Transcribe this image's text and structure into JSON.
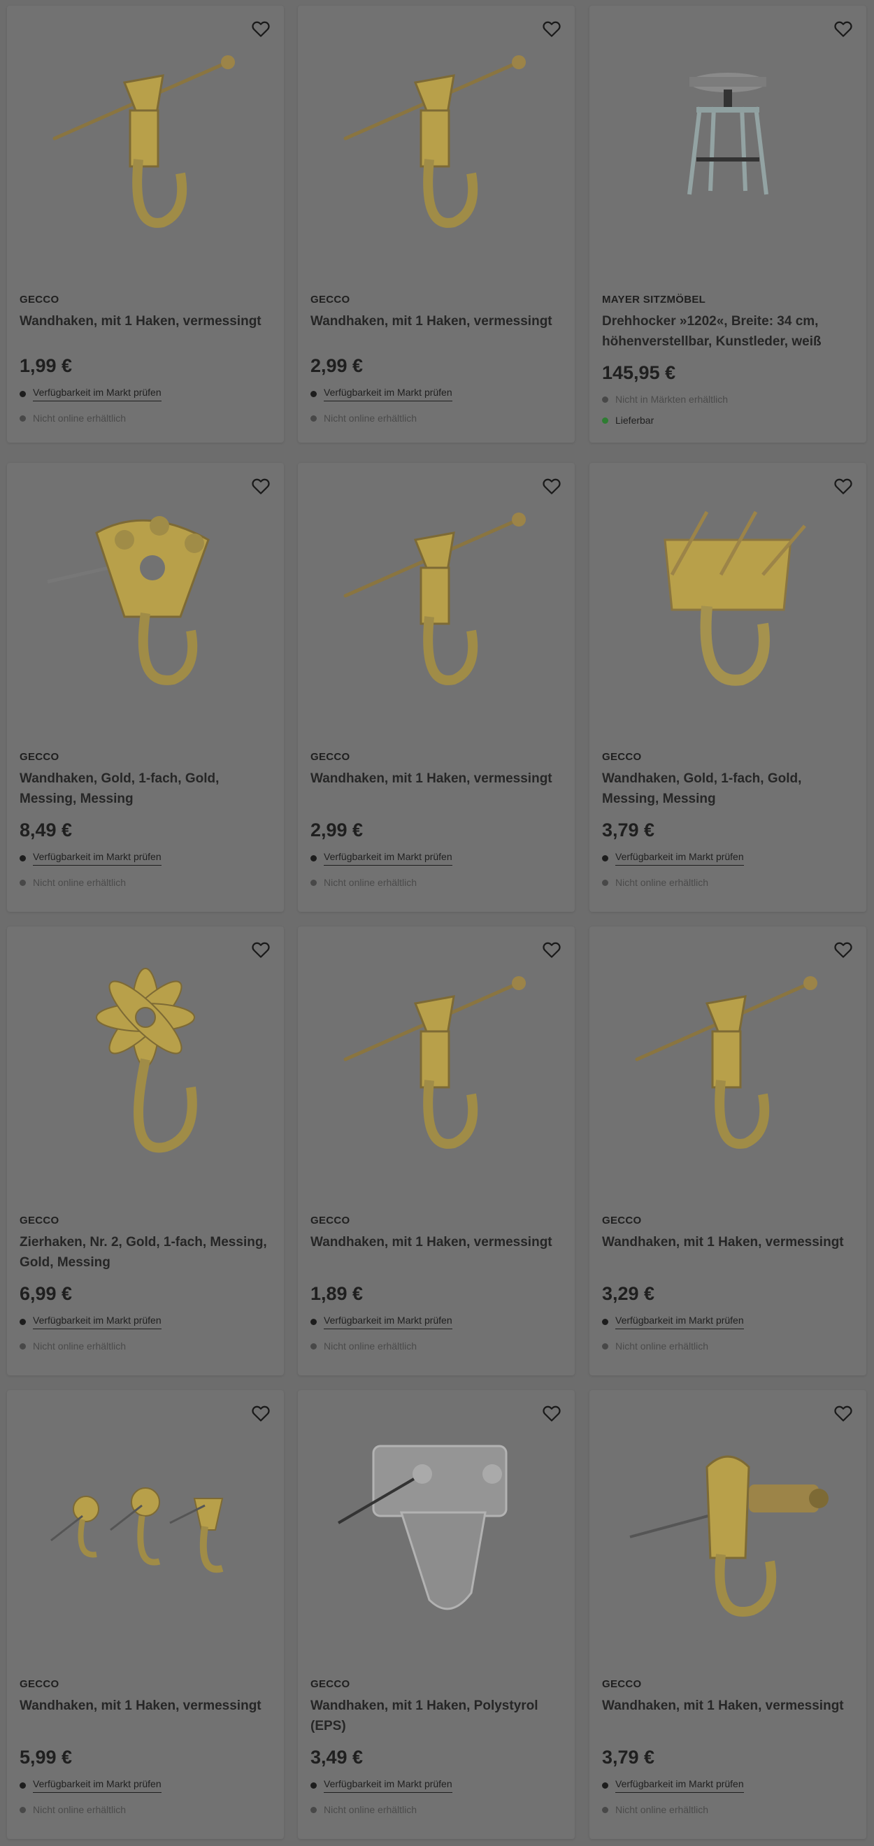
{
  "accent_gold": "#b8a04a",
  "status_colors": {
    "available": "#2e7d32",
    "unavailable": "#484848"
  },
  "products": [
    {
      "brand": "GECCO",
      "title": "Wandhaken, mit 1 Haken, vermessingt",
      "price": "1,99 €",
      "line1": "Verfügbarkeit im Markt prüfen",
      "line2": "Nicht online erhältlich",
      "image": "nail-hook-icon"
    },
    {
      "brand": "GECCO",
      "title": "Wandhaken, mit 1 Haken, vermessingt",
      "price": "2,99 €",
      "line1": "Verfügbarkeit im Markt prüfen",
      "line2": "Nicht online erhältlich",
      "image": "nail-hook-icon"
    },
    {
      "brand": "MAYER SITZMÖBEL",
      "title": "Drehhocker »1202«, Breite: 34 cm, höhenverstellbar, Kunstleder, weiß",
      "price": "145,95 €",
      "line1": "Nicht in Märkten erhältlich",
      "line2": "Lieferbar",
      "image": "stool-icon"
    },
    {
      "brand": "GECCO",
      "title": "Wandhaken, Gold, 1-fach, Gold, Messing, Messing",
      "price": "8,49 €",
      "line1": "Verfügbarkeit im Markt prüfen",
      "line2": "Nicht online erhältlich",
      "image": "plate-hook-icon"
    },
    {
      "brand": "GECCO",
      "title": "Wandhaken, mit 1 Haken, vermessingt",
      "price": "2,99 €",
      "line1": "Verfügbarkeit im Markt prüfen",
      "line2": "Nicht online erhältlich",
      "image": "nail-hook-icon"
    },
    {
      "brand": "GECCO",
      "title": "Wandhaken, Gold, 1-fach, Gold, Messing, Messing",
      "price": "3,79 €",
      "line1": "Verfügbarkeit im Markt prüfen",
      "line2": "Nicht online erhältlich",
      "image": "triple-nail-hook-icon"
    },
    {
      "brand": "GECCO",
      "title": "Zierhaken, Nr. 2, Gold, 1-fach, Messing, Gold, Messing",
      "price": "6,99 €",
      "line1": "Verfügbarkeit im Markt prüfen",
      "line2": "Nicht online erhältlich",
      "image": "flower-hook-icon"
    },
    {
      "brand": "GECCO",
      "title": "Wandhaken, mit 1 Haken, vermessingt",
      "price": "1,89 €",
      "line1": "Verfügbarkeit im Markt prüfen",
      "line2": "Nicht online erhältlich",
      "image": "nail-hook-icon"
    },
    {
      "brand": "GECCO",
      "title": "Wandhaken, mit 1 Haken, vermessingt",
      "price": "3,29 €",
      "line1": "Verfügbarkeit im Markt prüfen",
      "line2": "Nicht online erhältlich",
      "image": "nail-hook-icon"
    },
    {
      "brand": "GECCO",
      "title": "Wandhaken, mit 1 Haken, vermessingt",
      "price": "5,99 €",
      "line1": "Verfügbarkeit im Markt prüfen",
      "line2": "Nicht online erhältlich",
      "image": "three-hooks-icon"
    },
    {
      "brand": "GECCO",
      "title": "Wandhaken, mit 1 Haken, Polystyrol (EPS)",
      "price": "3,49 €",
      "line1": "Verfügbarkeit im Markt prüfen",
      "line2": "Nicht online erhältlich",
      "image": "plastic-hook-icon"
    },
    {
      "brand": "GECCO",
      "title": "Wandhaken, mit 1 Haken, vermessingt",
      "price": "3,79 €",
      "line1": "Verfügbarkeit im Markt prüfen",
      "line2": "Nicht online erhältlich",
      "image": "screw-hook-icon"
    }
  ]
}
